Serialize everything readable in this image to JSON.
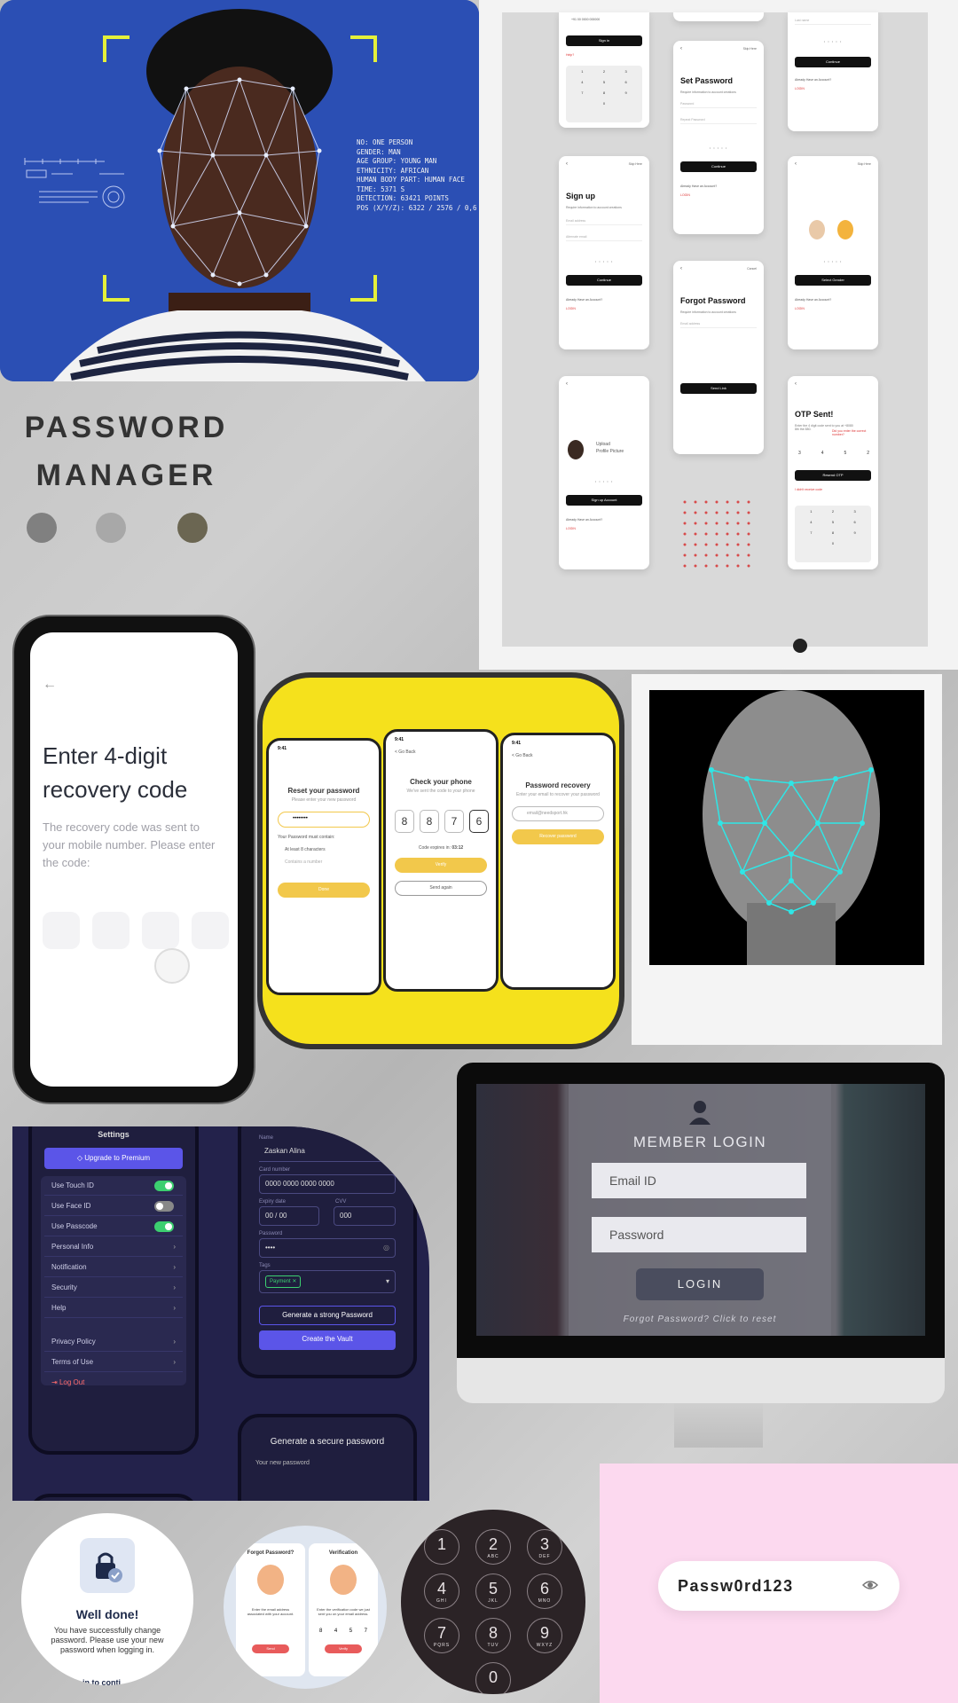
{
  "faceScan": {
    "readout": [
      "NO: ONE PERSON",
      "GENDER: MAN",
      "AGE GROUP: YOUNG MAN",
      "ETHNICITY: AFRICAN",
      "HUMAN BODY PART: HUMAN FACE",
      "TIME: 5371 S",
      "DETECTION: 63421 POINTS",
      "POS (X/Y/Z): 6322 / 2576 / 0,6"
    ]
  },
  "title": {
    "line1": "PASSWORD",
    "line2": "MANAGER"
  },
  "palette": {
    "dot1": "#808080",
    "dot2": "#a8a8a8",
    "dot3": "#6b6652",
    "yellow": "#f5e11c",
    "accentPurple": "#5b55e8",
    "toggleGreen": "#3ccf70",
    "pink": "#fcd9ef"
  },
  "screens": {
    "signIn": {
      "button": "Sign in",
      "help": "Help?",
      "phone": "+91 00 0000 000000",
      "keys": [
        "1",
        "2",
        "3",
        "4",
        "5",
        "6",
        "7",
        "8",
        "9",
        "0"
      ]
    },
    "setPassword": {
      "title": "Set Password",
      "sub": "Require information to account creations",
      "f1": "Password",
      "f2": "Repeat Password",
      "button": "Continue",
      "account": "Already Have an Account?",
      "login": "LOGIN"
    },
    "topRight": {
      "f1": "Last name",
      "button": "Continue",
      "account": "Already Have an Account?",
      "login": "LOGIN"
    },
    "signUp": {
      "skip": "Skip Here",
      "title": "Sign up",
      "sub": "Require information to account creations",
      "f1": "Email address",
      "f2": "Alternate email",
      "button": "Continue",
      "account": "Already Have an Account?",
      "login": "LOGIN"
    },
    "gender": {
      "skip": "Skip Here",
      "button": "Select Gender",
      "account": "Already Have an Account?",
      "login": "LOGIN"
    },
    "forgot": {
      "cancel": "Cancel",
      "title": "Forgot Password",
      "sub": "Require information to account creations",
      "f1": "Email address",
      "button": "Send Link"
    },
    "upload": {
      "label1": "Upload",
      "label2": "Profile Picture",
      "button": "Sign up Account",
      "account": "Already Have an Account?",
      "login": "LOGIN"
    },
    "otp": {
      "title": "OTP Sent!",
      "sub": "Enter the 4 digit code sent to you at +8080 8th the 880.",
      "subRed": "Did you enter the correct number?",
      "digits": [
        "3",
        "4",
        "5",
        "2"
      ],
      "button": "Resend OTP",
      "notReceived": "I didn't receive code",
      "keys": [
        "1",
        "2",
        "3",
        "4",
        "5",
        "6",
        "7",
        "8",
        "9",
        "0"
      ]
    }
  },
  "recovery": {
    "title": "Enter 4-digit recovery code",
    "body": "The recovery code was sent to your mobile number. Please enter the code:"
  },
  "yellowPhones": {
    "p1": {
      "time": "9:41",
      "title": "Reset your password",
      "sub": "Please enter your new password",
      "value": "••••••••",
      "check1": "Your Password must contain:",
      "check2": "At least 8 characters",
      "check3": "Contains a number",
      "button": "Done"
    },
    "p2": {
      "time": "9:41",
      "back": "< Go Back",
      "title": "Check your phone",
      "sub": "We've sent the code to your phone",
      "digits": [
        "8",
        "8",
        "7",
        "6"
      ],
      "expires": "Code expires in:",
      "timer": "03:12",
      "verify": "Verify",
      "resend": "Send again"
    },
    "p3": {
      "time": "9:41",
      "back": "< Go Back",
      "title": "Password recovery",
      "sub": "Enter your email to recover your password",
      "email": "email@needsport.hk",
      "button": "Recover password"
    }
  },
  "vault": {
    "settingsTitle": "Settings",
    "premium": "Upgrade to Premium",
    "toggles": [
      {
        "label": "Use Touch ID",
        "on": true
      },
      {
        "label": "Use Face ID",
        "on": false
      },
      {
        "label": "Use Passcode",
        "on": true
      }
    ],
    "menu": [
      "Personal Info",
      "Notification",
      "Security",
      "Help"
    ],
    "menu2": [
      "Privacy Policy",
      "Terms of Use"
    ],
    "logout": "Log Out",
    "form": {
      "nameLabel": "Name",
      "name": "Zaskan Alina",
      "cardLabel": "Card number",
      "card": "0000 0000 0000 0000",
      "expLabel": "Expiry date",
      "exp": "00 / 00",
      "cvvLabel": "CVV",
      "cvv": "000",
      "pwLabel": "Password",
      "pw": "••••",
      "tagsLabel": "Tags",
      "tag": "Payment",
      "generate": "Generate a strong Password",
      "create": "Create the Vault"
    },
    "secure": {
      "title": "Generate a secure password",
      "label": "Your new password"
    }
  },
  "memberLogin": {
    "title": "MEMBER LOGIN",
    "email": "Email ID",
    "password": "Password",
    "button": "LOGIN",
    "forgot": "Forgot Password? Click to reset"
  },
  "wellDone": {
    "title": "Well done!",
    "body": "You have successfully change password. Please use your new password when logging in.",
    "footer": "Log in to conti"
  },
  "verifyCircle": {
    "c1": "Forgot Password?",
    "c2": "Verification",
    "c1body": "Enter the email address associated with your account.",
    "c2body": "Enter the verification code we just sent you on your email address.",
    "digits": [
      "8",
      "4",
      "5",
      "7"
    ],
    "btn1": "Send",
    "btn2": "Verify"
  },
  "keypad": [
    {
      "n": "1",
      "l": ""
    },
    {
      "n": "2",
      "l": "ABC"
    },
    {
      "n": "3",
      "l": "DEF"
    },
    {
      "n": "4",
      "l": "GHI"
    },
    {
      "n": "5",
      "l": "JKL"
    },
    {
      "n": "6",
      "l": "MNO"
    },
    {
      "n": "7",
      "l": "PQRS"
    },
    {
      "n": "8",
      "l": "TUV"
    },
    {
      "n": "9",
      "l": "WXYZ"
    },
    {
      "n": "0",
      "l": ""
    }
  ],
  "pinkField": {
    "value": "Passw0rd123"
  }
}
